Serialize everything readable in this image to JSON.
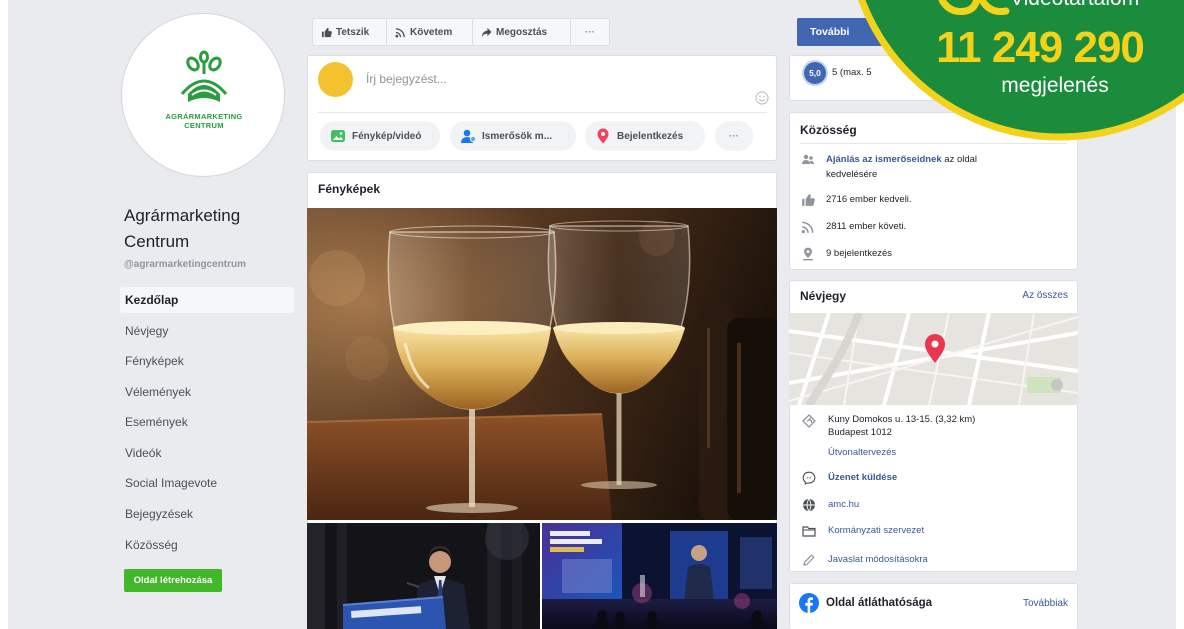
{
  "overlay": {
    "top_label": "Videótartalom",
    "count": "11 249 290",
    "count_label": "megjelenés",
    "colors": {
      "fill": "#1b8b3c",
      "ring": "#f3d21b",
      "count": "#f3d21b"
    }
  },
  "page": {
    "name": "Agrármarketing Centrum",
    "handle": "@agrarmarketingcentrum",
    "logo_line1": "AGRÁRMARKETING",
    "logo_line2": "CENTRUM"
  },
  "nav": [
    {
      "label": "Kezdőlap",
      "selected": true
    },
    {
      "label": "Névjegy",
      "selected": false
    },
    {
      "label": "Fényképek",
      "selected": false
    },
    {
      "label": "Vélemények",
      "selected": false
    },
    {
      "label": "Események",
      "selected": false
    },
    {
      "label": "Videók",
      "selected": false
    },
    {
      "label": "Social Imagevote",
      "selected": false
    },
    {
      "label": "Bejegyzések",
      "selected": false
    },
    {
      "label": "Közösség",
      "selected": false
    }
  ],
  "create_page_button": "Oldal létrehozása",
  "actions": {
    "like": "Tetszik",
    "follow": "Követem",
    "share": "Megosztás",
    "more": "···"
  },
  "composer": {
    "placeholder": "Írj bejegyzést...",
    "photo_video": "Fénykép/videó",
    "tag_friends": "Ismerősök m...",
    "check_in": "Bejelentkezés",
    "more": "···"
  },
  "photos": {
    "title": "Fényképek"
  },
  "more_button": "További",
  "rating": {
    "badge": "5,0",
    "text": "5 (max. 5"
  },
  "community": {
    "title": "Közösség",
    "invite_link": "Ajánlás az ismerőseidnek",
    "invite_rest": " az oldal kedvelésére",
    "likes": "2716 ember kedveli.",
    "follows": "2811 ember követi.",
    "checkins": "9 bejelentkezés"
  },
  "about": {
    "title": "Névjegy",
    "see_all": "Az összes",
    "address_line1": "Kuny Domokos u. 13-15. (3,32 km)",
    "address_line2": "Budapest 1012",
    "directions": "Útvonaltervezés",
    "message": "Üzenet küldése",
    "website": "amc.hu",
    "category": "Kormányzati szervezet",
    "suggest_edits": "Javaslat módosításokra"
  },
  "transparency": {
    "title": "Oldal átláthatósága",
    "see_more": "Továbbiak"
  },
  "colors": {
    "fb_blue": "#4267b2",
    "link": "#385898",
    "green_button": "#42b72a",
    "page_bg": "#e9ebee",
    "logo_green": "#2a9d3f"
  }
}
